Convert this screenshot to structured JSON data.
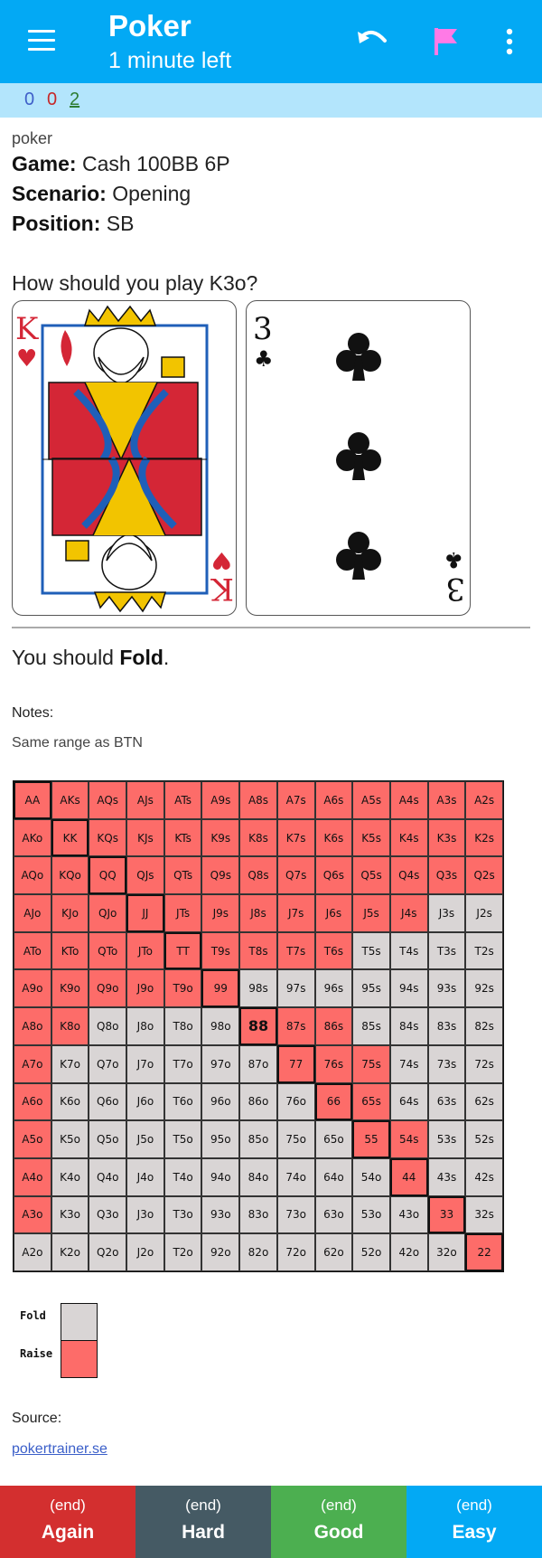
{
  "appbar": {
    "title": "Poker",
    "subtitle": "1 minute left",
    "menu_icon": "hamburger-menu-icon",
    "undo_icon": "undo-icon",
    "flag_icon": "flag-icon",
    "more_icon": "more-vert-icon",
    "colors": {
      "bar": "#03a9f4",
      "flag": "#ff7ae6"
    }
  },
  "counts": {
    "new": "0",
    "learning": "0",
    "review": "2",
    "colors": {
      "new": "#3e5ec8",
      "learning": "#c62828",
      "review": "#2e7d32"
    }
  },
  "card": {
    "deck": "poker",
    "game_label": "Game:",
    "game_value": "Cash 100BB 6P",
    "scenario_label": "Scenario:",
    "scenario_value": "Opening",
    "position_label": "Position:",
    "position_value": "SB",
    "question": "How should you play K3o?",
    "card1": {
      "rank": "K",
      "suit": "hearts",
      "suit_symbol": "♥"
    },
    "card2": {
      "rank": "3",
      "suit": "clubs",
      "suit_symbol": "♣"
    },
    "answer_prefix": "You should ",
    "answer_action": "Fold",
    "answer_suffix": ".",
    "notes_label": "Notes:",
    "notes_text": "Same range as BTN"
  },
  "range": {
    "highlight": "88",
    "colors": {
      "raise": "#fd6c69",
      "fold": "#d9d5d5"
    },
    "rows": [
      [
        "AA",
        "AKs",
        "AQs",
        "AJs",
        "ATs",
        "A9s",
        "A8s",
        "A7s",
        "A6s",
        "A5s",
        "A4s",
        "A3s",
        "A2s"
      ],
      [
        "AKo",
        "KK",
        "KQs",
        "KJs",
        "KTs",
        "K9s",
        "K8s",
        "K7s",
        "K6s",
        "K5s",
        "K4s",
        "K3s",
        "K2s"
      ],
      [
        "AQo",
        "KQo",
        "QQ",
        "QJs",
        "QTs",
        "Q9s",
        "Q8s",
        "Q7s",
        "Q6s",
        "Q5s",
        "Q4s",
        "Q3s",
        "Q2s"
      ],
      [
        "AJo",
        "KJo",
        "QJo",
        "JJ",
        "JTs",
        "J9s",
        "J8s",
        "J7s",
        "J6s",
        "J5s",
        "J4s",
        "J3s",
        "J2s"
      ],
      [
        "ATo",
        "KTo",
        "QTo",
        "JTo",
        "TT",
        "T9s",
        "T8s",
        "T7s",
        "T6s",
        "T5s",
        "T4s",
        "T3s",
        "T2s"
      ],
      [
        "A9o",
        "K9o",
        "Q9o",
        "J9o",
        "T9o",
        "99",
        "98s",
        "97s",
        "96s",
        "95s",
        "94s",
        "93s",
        "92s"
      ],
      [
        "A8o",
        "K8o",
        "Q8o",
        "J8o",
        "T8o",
        "98o",
        "88",
        "87s",
        "86s",
        "85s",
        "84s",
        "83s",
        "82s"
      ],
      [
        "A7o",
        "K7o",
        "Q7o",
        "J7o",
        "T7o",
        "97o",
        "87o",
        "77",
        "76s",
        "75s",
        "74s",
        "73s",
        "72s"
      ],
      [
        "A6o",
        "K6o",
        "Q6o",
        "J6o",
        "T6o",
        "96o",
        "86o",
        "76o",
        "66",
        "65s",
        "64s",
        "63s",
        "62s"
      ],
      [
        "A5o",
        "K5o",
        "Q5o",
        "J5o",
        "T5o",
        "95o",
        "85o",
        "75o",
        "65o",
        "55",
        "54s",
        "53s",
        "52s"
      ],
      [
        "A4o",
        "K4o",
        "Q4o",
        "J4o",
        "T4o",
        "94o",
        "84o",
        "74o",
        "64o",
        "54o",
        "44",
        "43s",
        "42s"
      ],
      [
        "A3o",
        "K3o",
        "Q3o",
        "J3o",
        "T3o",
        "93o",
        "83o",
        "73o",
        "63o",
        "53o",
        "43o",
        "33",
        "32s"
      ],
      [
        "A2o",
        "K2o",
        "Q2o",
        "J2o",
        "T2o",
        "92o",
        "82o",
        "72o",
        "62o",
        "52o",
        "42o",
        "32o",
        "22"
      ]
    ],
    "actions": [
      [
        "R",
        "R",
        "R",
        "R",
        "R",
        "R",
        "R",
        "R",
        "R",
        "R",
        "R",
        "R",
        "R"
      ],
      [
        "R",
        "R",
        "R",
        "R",
        "R",
        "R",
        "R",
        "R",
        "R",
        "R",
        "R",
        "R",
        "R"
      ],
      [
        "R",
        "R",
        "R",
        "R",
        "R",
        "R",
        "R",
        "R",
        "R",
        "R",
        "R",
        "R",
        "R"
      ],
      [
        "R",
        "R",
        "R",
        "R",
        "R",
        "R",
        "R",
        "R",
        "R",
        "R",
        "R",
        "F",
        "F"
      ],
      [
        "R",
        "R",
        "R",
        "R",
        "R",
        "R",
        "R",
        "R",
        "R",
        "F",
        "F",
        "F",
        "F"
      ],
      [
        "R",
        "R",
        "R",
        "R",
        "R",
        "R",
        "F",
        "F",
        "F",
        "F",
        "F",
        "F",
        "F"
      ],
      [
        "R",
        "R",
        "F",
        "F",
        "F",
        "F",
        "R",
        "R",
        "R",
        "F",
        "F",
        "F",
        "F"
      ],
      [
        "R",
        "F",
        "F",
        "F",
        "F",
        "F",
        "F",
        "R",
        "R",
        "R",
        "F",
        "F",
        "F"
      ],
      [
        "R",
        "F",
        "F",
        "F",
        "F",
        "F",
        "F",
        "F",
        "R",
        "R",
        "F",
        "F",
        "F"
      ],
      [
        "R",
        "F",
        "F",
        "F",
        "F",
        "F",
        "F",
        "F",
        "F",
        "R",
        "R",
        "F",
        "F"
      ],
      [
        "R",
        "F",
        "F",
        "F",
        "F",
        "F",
        "F",
        "F",
        "F",
        "F",
        "R",
        "F",
        "F"
      ],
      [
        "R",
        "F",
        "F",
        "F",
        "F",
        "F",
        "F",
        "F",
        "F",
        "F",
        "F",
        "R",
        "F"
      ],
      [
        "F",
        "F",
        "F",
        "F",
        "F",
        "F",
        "F",
        "F",
        "F",
        "F",
        "F",
        "F",
        "R"
      ]
    ]
  },
  "legend": [
    {
      "label": "Fold",
      "color": "#d9d5d5"
    },
    {
      "label": "Raise",
      "color": "#fd6c69"
    }
  ],
  "source": {
    "label": "Source:",
    "link_text": "pokertrainer.se"
  },
  "buttons": [
    {
      "sub": "(end)",
      "label": "Again",
      "color": "#d32f2f"
    },
    {
      "sub": "(end)",
      "label": "Hard",
      "color": "#455a64"
    },
    {
      "sub": "(end)",
      "label": "Good",
      "color": "#4caf50"
    },
    {
      "sub": "(end)",
      "label": "Easy",
      "color": "#03a9f4"
    }
  ]
}
